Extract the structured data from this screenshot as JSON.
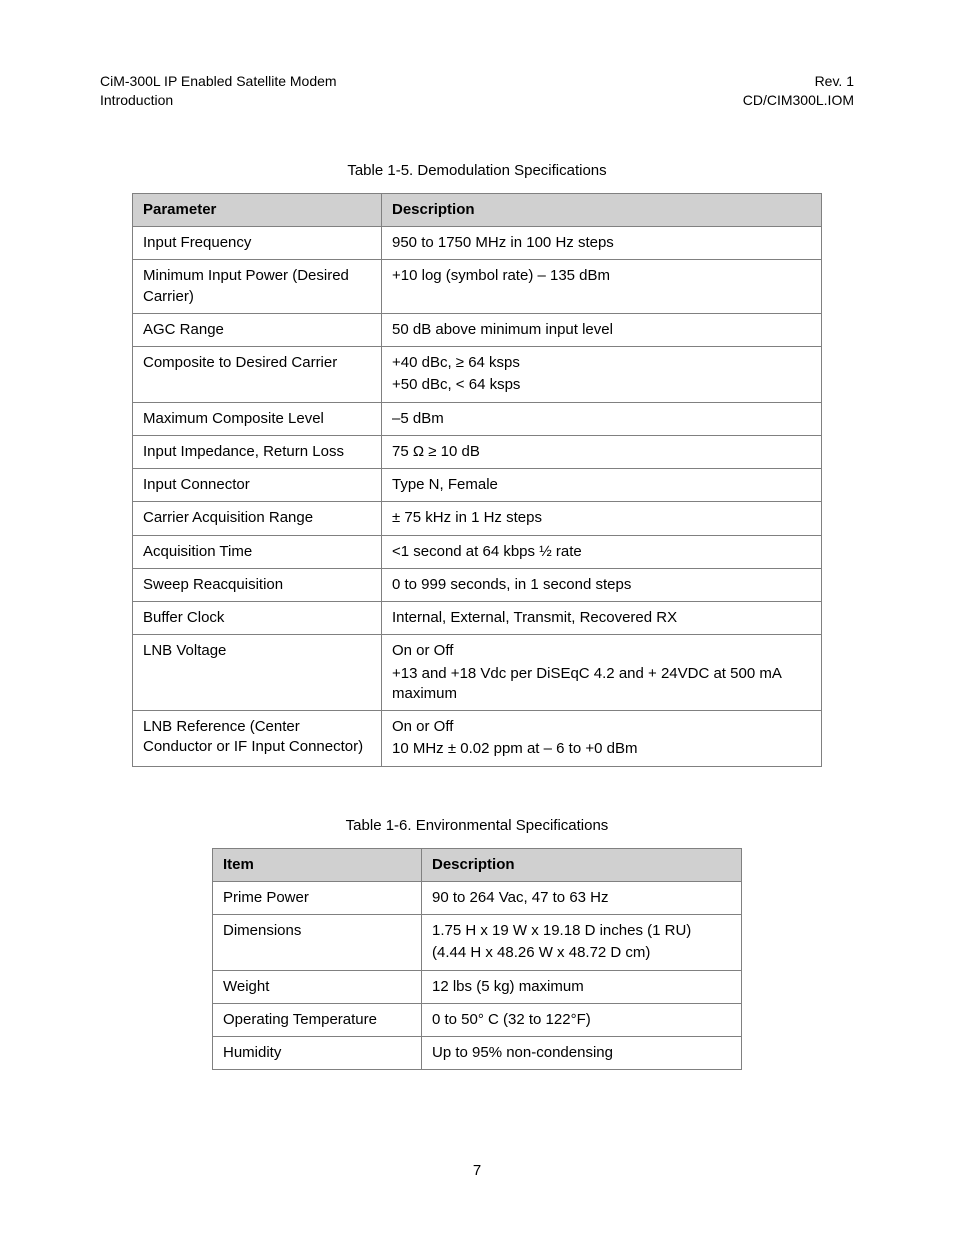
{
  "header": {
    "left_line1": "CiM-300L IP Enabled Satellite Modem",
    "left_line2": "Introduction",
    "right_line1": "Rev. 1",
    "right_line2": "CD/CIM300L.IOM"
  },
  "table1": {
    "title": "Table 1-5.  Demodulation Specifications",
    "col1": "Parameter",
    "col2": "Description",
    "rows": [
      {
        "p": "Input Frequency",
        "d": [
          "950 to 1750 MHz in 100 Hz steps"
        ]
      },
      {
        "p": "Minimum Input Power (Desired Carrier)",
        "d": [
          "+10 log (symbol rate) – 135 dBm"
        ]
      },
      {
        "p": "AGC Range",
        "d": [
          "50 dB above minimum input level"
        ]
      },
      {
        "p": "Composite to Desired Carrier",
        "d": [
          "+40 dBc, ≥ 64 ksps",
          "+50 dBc, < 64 ksps"
        ]
      },
      {
        "p": "Maximum Composite Level",
        "d": [
          "–5 dBm"
        ]
      },
      {
        "p": "Input Impedance, Return Loss",
        "d": [
          "75 Ω  ≥ 10 dB"
        ]
      },
      {
        "p": "Input Connector",
        "d": [
          "Type N, Female"
        ]
      },
      {
        "p": "Carrier Acquisition Range",
        "d": [
          "± 75 kHz in 1 Hz steps"
        ]
      },
      {
        "p": "Acquisition Time",
        "d": [
          "<1 second at 64 kbps ½ rate"
        ]
      },
      {
        "p": "Sweep Reacquisition",
        "d": [
          "0 to 999 seconds, in 1 second steps"
        ]
      },
      {
        "p": "Buffer Clock",
        "d": [
          "Internal, External, Transmit, Recovered RX"
        ]
      },
      {
        "p": "LNB Voltage",
        "d": [
          "On or Off",
          "+13 and +18 Vdc per DiSEqC 4.2 and + 24VDC at 500 mA maximum"
        ]
      },
      {
        "p": "LNB Reference (Center Conductor or IF Input Connector)",
        "d": [
          "On or Off",
          "10 MHz ± 0.02 ppm at – 6 to +0 dBm"
        ]
      }
    ]
  },
  "table2": {
    "title": "Table 1-6.  Environmental Specifications",
    "col1": "Item",
    "col2": "Description",
    "rows": [
      {
        "p": "Prime Power",
        "d": [
          "90 to 264 Vac, 47 to 63 Hz"
        ]
      },
      {
        "p": "Dimensions",
        "d": [
          "1.75 H x 19 W x 19.18 D inches (1 RU)",
          "(4.44 H x 48.26 W x 48.72 D cm)"
        ]
      },
      {
        "p": "Weight",
        "d": [
          "12 lbs (5 kg) maximum"
        ]
      },
      {
        "p": "Operating Temperature",
        "d": [
          "0 to 50° C (32 to 122°F)"
        ]
      },
      {
        "p": "Humidity",
        "d": [
          "Up to 95% non-condensing"
        ]
      }
    ]
  },
  "page_number": "7"
}
